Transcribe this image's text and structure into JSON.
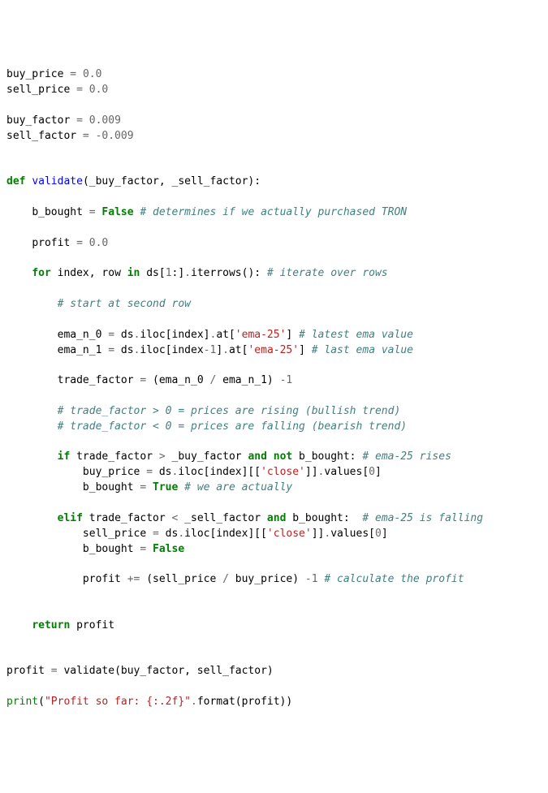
{
  "code": {
    "line1": {
      "v1": "buy_price",
      "op": "=",
      "n": "0.0"
    },
    "line2": {
      "v1": "sell_price",
      "op": "=",
      "n": "0.0"
    },
    "line3": {
      "v1": "buy_factor",
      "op": "=",
      "n": "0.009"
    },
    "line4": {
      "v1": "sell_factor",
      "op": "=",
      "n": "-",
      "n2": "0.009"
    },
    "def": {
      "kw": "def",
      "name": "validate",
      "p": "(_buy_factor, _sell_factor):"
    },
    "l5": {
      "v": "b_bought",
      "op": "=",
      "val": "False",
      "c": "# determines if we actually purchased TRON"
    },
    "l6": {
      "v": "profit",
      "op": "=",
      "n": "0.0"
    },
    "l7": {
      "kw1": "for",
      "t1": " index, row ",
      "kw2": "in",
      "t2": " ds[",
      "n": "1",
      "t3": ":]",
      "d": ".",
      "m": "iterrows():",
      "c": "# iterate over rows"
    },
    "l8": {
      "c": "# start at second row"
    },
    "l9": {
      "v": "ema_n_0",
      "eq": "=",
      "t1": " ds",
      "d1": ".",
      "m1": "iloc[index]",
      "d2": ".",
      "m2": "at[",
      "s": "'ema-25'",
      "t2": "]",
      "c": "# latest ema value"
    },
    "l10": {
      "v": "ema_n_1",
      "eq": "=",
      "t1": " ds",
      "d1": ".",
      "m1": "iloc[index",
      "op": "-",
      "n": "1",
      "t1b": "]",
      "d2": ".",
      "m2": "at[",
      "s": "'ema-25'",
      "t2": "]",
      "c": "# last ema value"
    },
    "l11": {
      "v": "trade_factor",
      "eq": "=",
      "t": " (ema_n_0 ",
      "op1": "/",
      "t2": " ema_n_1) ",
      "op2": "-",
      "n": "1"
    },
    "l12": {
      "c": "# trade_factor > 0 = prices are rising (bullish trend)"
    },
    "l13": {
      "c": "# trade_factor < 0 = prices are falling (bearish trend)"
    },
    "l14": {
      "kw1": "if",
      "t1": " trade_factor ",
      "op": ">",
      "t2": " _buy_factor ",
      "kw2": "and",
      "sp": " ",
      "kw3": "not",
      "t3": " b_bought:",
      "c": "# ema-25 rises"
    },
    "l15": {
      "v": "buy_price",
      "eq": "=",
      "t": " ds",
      "d": ".",
      "m": "iloc[index][[",
      "s": "'close'",
      "t2": "]]",
      "d2": ".",
      "m2": "values[",
      "n": "0",
      "t3": "]"
    },
    "l16": {
      "v": "b_bought",
      "eq": "=",
      "val": "True",
      "c": "# we are actually"
    },
    "l17": {
      "kw1": "elif",
      "t1": " trade_factor ",
      "op": "<",
      "t2": " _sell_factor ",
      "kw2": "and",
      "t3": " b_bought:",
      "c": "# ema-25 is falling"
    },
    "l18": {
      "v": "sell_price",
      "eq": "=",
      "t": " ds",
      "d": ".",
      "m": "iloc[index][[",
      "s": "'close'",
      "t2": "]]",
      "d2": ".",
      "m2": "values[",
      "n": "0",
      "t3": "]"
    },
    "l19": {
      "v": "b_bought",
      "eq": "=",
      "val": "False"
    },
    "l20": {
      "v": "profit",
      "eq": "+=",
      "t": " (sell_price ",
      "op": "/",
      "t2": " buy_price) ",
      "op2": "-",
      "n": "1",
      "c": "# calculate the profit"
    },
    "l21": {
      "kw": "return",
      "t": " profit"
    },
    "l22": {
      "v": "profit",
      "eq": "=",
      "t": " validate(buy_factor, sell_factor)"
    },
    "l23": {
      "fn": "print",
      "t1": "(",
      "s": "\"Profit so far: {:.2f}\"",
      "d": ".",
      "m": "format(profit))"
    }
  }
}
